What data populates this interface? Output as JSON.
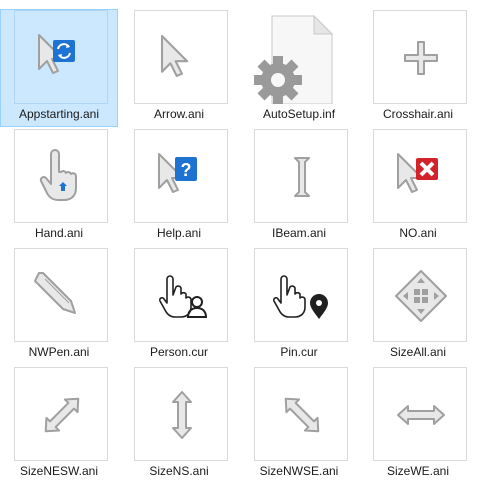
{
  "files": [
    {
      "name": "Appstarting.ani",
      "icon": "appstarting-cursor-icon",
      "selected": true
    },
    {
      "name": "Arrow.ani",
      "icon": "arrow-cursor-icon"
    },
    {
      "name": "AutoSetup.inf",
      "icon": "setup-gear-file-icon"
    },
    {
      "name": "Crosshair.ani",
      "icon": "crosshair-cursor-icon"
    },
    {
      "name": "Hand.ani",
      "icon": "hand-cursor-icon"
    },
    {
      "name": "Help.ani",
      "icon": "help-cursor-icon"
    },
    {
      "name": "IBeam.ani",
      "icon": "ibeam-cursor-icon"
    },
    {
      "name": "NO.ani",
      "icon": "no-cursor-icon"
    },
    {
      "name": "NWPen.ani",
      "icon": "pen-cursor-icon"
    },
    {
      "name": "Person.cur",
      "icon": "person-cursor-icon"
    },
    {
      "name": "Pin.cur",
      "icon": "pin-cursor-icon"
    },
    {
      "name": "SizeAll.ani",
      "icon": "size-all-cursor-icon"
    },
    {
      "name": "SizeNESW.ani",
      "icon": "size-nesw-cursor-icon"
    },
    {
      "name": "SizeNS.ani",
      "icon": "size-ns-cursor-icon"
    },
    {
      "name": "SizeNWSE.ani",
      "icon": "size-nwse-cursor-icon"
    },
    {
      "name": "SizeWE.ani",
      "icon": "size-we-cursor-icon"
    }
  ],
  "colors": {
    "accent": "#1e73d2",
    "selection": "#cce8ff",
    "error": "#d3222a",
    "cursor_fill": "#e8e8e8",
    "cursor_stroke": "#a0a0a0"
  }
}
